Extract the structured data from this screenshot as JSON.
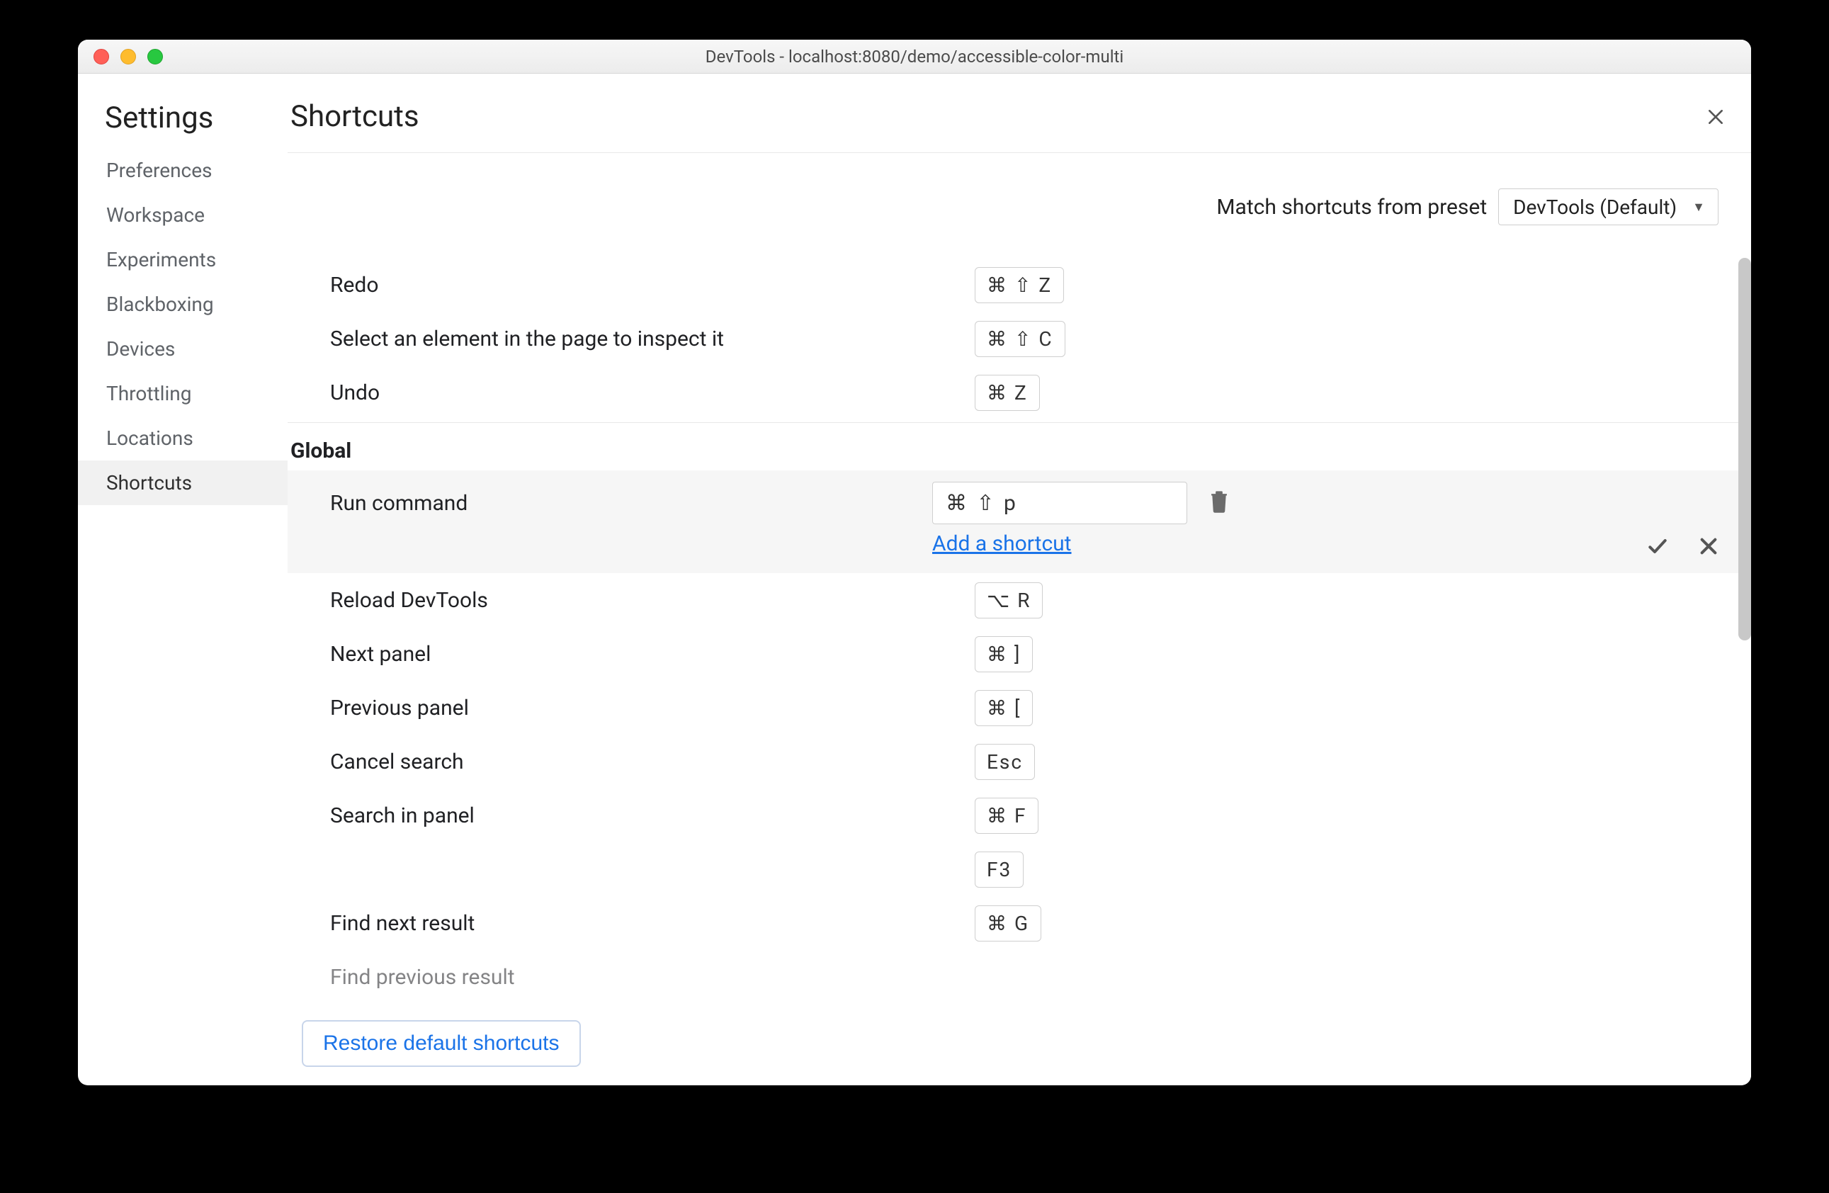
{
  "window": {
    "title": "DevTools - localhost:8080/demo/accessible-color-multi"
  },
  "sidebar": {
    "title": "Settings",
    "items": [
      {
        "label": "Preferences"
      },
      {
        "label": "Workspace"
      },
      {
        "label": "Experiments"
      },
      {
        "label": "Blackboxing"
      },
      {
        "label": "Devices"
      },
      {
        "label": "Throttling"
      },
      {
        "label": "Locations"
      },
      {
        "label": "Shortcuts"
      }
    ],
    "selected_index": 7
  },
  "main": {
    "title": "Shortcuts",
    "preset_label": "Match shortcuts from preset",
    "preset_value": "DevTools (Default)"
  },
  "top_rows": [
    {
      "label": "Redo",
      "keys": "⌘ ⇧ Z"
    },
    {
      "label": "Select an element in the page to inspect it",
      "keys": "⌘ ⇧ C"
    },
    {
      "label": "Undo",
      "keys": "⌘ Z"
    }
  ],
  "section": {
    "title": "Global",
    "editing": {
      "label": "Run command",
      "input_value": "⌘ ⇧ p",
      "add_link": "Add a shortcut"
    },
    "rows": [
      {
        "label": "Reload DevTools",
        "keys": "⌥ R"
      },
      {
        "label": "Next panel",
        "keys": "⌘ ]"
      },
      {
        "label": "Previous panel",
        "keys": "⌘ ["
      },
      {
        "label": "Cancel search",
        "keys": "Esc"
      },
      {
        "label": "Search in panel",
        "keys": "⌘ F"
      },
      {
        "label": "",
        "keys": "F3"
      },
      {
        "label": "Find next result",
        "keys": "⌘ G"
      },
      {
        "label": "Find previous result",
        "keys": ""
      }
    ]
  },
  "footer": {
    "restore": "Restore default shortcuts"
  }
}
